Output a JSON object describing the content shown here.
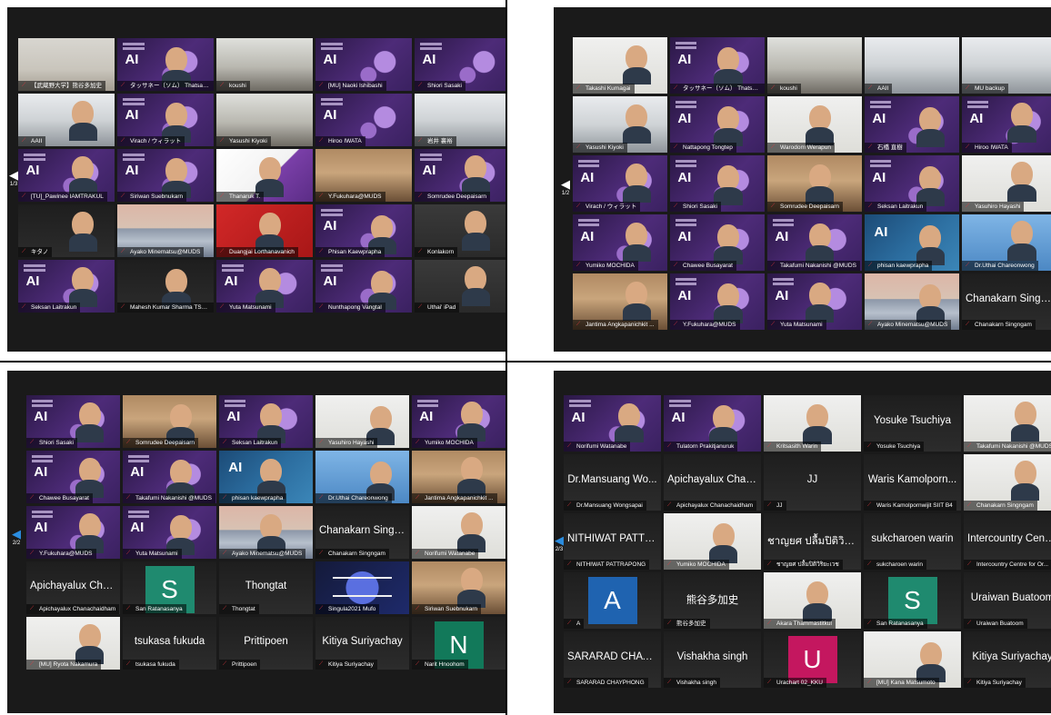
{
  "panels": [
    {
      "page": "1/3",
      "tiles": [
        {
          "name": "【武蔵野大学】熊谷多加史",
          "photo": "p-wall"
        },
        {
          "name": "タッサネー（ソム） Thatsanee (...",
          "photo": "p-ai",
          "face": true
        },
        {
          "name": "koushi",
          "photo": "p-room"
        },
        {
          "name": "[MU] Naoki Ishibashi",
          "photo": "p-ai"
        },
        {
          "name": "Shiori Sasaki",
          "photo": "p-ai"
        },
        {
          "name": "AAII",
          "photo": "p-office",
          "face": true
        },
        {
          "name": "Virach / ウィラット",
          "photo": "p-ai",
          "face": true,
          "highlight": true
        },
        {
          "name": "Yasushi Kiyoki",
          "photo": "p-room"
        },
        {
          "name": "Hiroo IWATA",
          "photo": "p-ai"
        },
        {
          "name": "岩井 裏裕",
          "photo": "p-office"
        },
        {
          "name": "[TU]_Pawinee IAMTRAKUL",
          "photo": "p-ai",
          "face": true
        },
        {
          "name": "Siriwan Suebnukarn",
          "photo": "p-ai",
          "face": true
        },
        {
          "name": "Thanaruk T.",
          "photo": "p-siit",
          "face": true
        },
        {
          "name": "Y.Fukuhara@MUDS",
          "photo": "p-home"
        },
        {
          "name": "Somrudee Deepaisarn",
          "photo": "p-ai",
          "face": true
        },
        {
          "name": "キタノ",
          "photo": "p-blk",
          "face": true
        },
        {
          "name": "Ayako Minematsu@MUDS",
          "photo": "p-mtn"
        },
        {
          "name": "Duangjai Lorthanavanich",
          "photo": "p-red",
          "face": true
        },
        {
          "name": "Phisan Kaewprapha",
          "photo": "p-ai",
          "face": true
        },
        {
          "name": "Konlakorn",
          "photo": "p-dark",
          "face": true
        },
        {
          "name": "Seksan Laitrakun",
          "photo": "p-ai",
          "face": true
        },
        {
          "name": "Mahesh Kumar Sharma TSE...",
          "photo": "p-blk",
          "face": true
        },
        {
          "name": "Yuta Matsunami",
          "photo": "p-ai",
          "face": true
        },
        {
          "name": "Nunthapong Vangtal",
          "photo": "p-ai",
          "face": true
        },
        {
          "name": "Uthai' iPad",
          "photo": "p-dark",
          "face": true
        }
      ]
    },
    {
      "page": "1/2",
      "tiles": [
        {
          "name": "Takashi Kumagai",
          "photo": "p-white",
          "face": true
        },
        {
          "name": "タッサネー（ソム） Thatsanee (...",
          "photo": "p-ai",
          "face": true
        },
        {
          "name": "koushi",
          "photo": "p-room",
          "highlight": true
        },
        {
          "name": "AAII",
          "photo": "p-office"
        },
        {
          "name": "MU backup",
          "photo": "p-office"
        },
        {
          "name": "Yasushi Kiyoki",
          "photo": "p-office",
          "face": true
        },
        {
          "name": "Nattapong Tongtep",
          "photo": "p-ai",
          "face": true
        },
        {
          "name": "Warodom Werapun",
          "photo": "p-white",
          "face": true
        },
        {
          "name": "石橋 直樹",
          "photo": "p-ai",
          "face": true
        },
        {
          "name": "Hiroo IWATA",
          "photo": "p-ai",
          "face": true
        },
        {
          "name": "Virach / ウィラット",
          "photo": "p-ai",
          "face": true
        },
        {
          "name": "Shiori Sasaki",
          "photo": "p-ai",
          "face": true
        },
        {
          "name": "Somrudee Deepaisarn",
          "photo": "p-home",
          "face": true
        },
        {
          "name": "Seksan Laitrakun",
          "photo": "p-ai",
          "face": true
        },
        {
          "name": "Yasuhiro Hayashi",
          "photo": "p-white",
          "face": true
        },
        {
          "name": "Yumiko MOCHIDA",
          "photo": "p-ai",
          "face": true
        },
        {
          "name": "Chawee Busayarat",
          "photo": "p-ai",
          "face": true
        },
        {
          "name": "Takafumi Nakanishi @MUDS",
          "photo": "p-ai",
          "face": true
        },
        {
          "name": "phisan kaewprapha",
          "photo": "p-ai2",
          "face": true
        },
        {
          "name": "Dr.Uthai Chareonwong",
          "photo": "p-blue",
          "face": true
        },
        {
          "name": "Jantima Angkapanichkit ...",
          "photo": "p-home",
          "face": true
        },
        {
          "name": "Y.Fukuhara@MUDS",
          "photo": "p-ai",
          "face": true
        },
        {
          "name": "Yuta Matsunami",
          "photo": "p-ai",
          "face": true
        },
        {
          "name": "Ayako Minematsu@MUDS",
          "photo": "p-mtn",
          "face": true
        },
        {
          "name": "Chanakarn Singngam",
          "photo": "p-blk",
          "label": "Chanakarn Singn..."
        }
      ]
    },
    {
      "page": "2/2",
      "tiles": [
        {
          "name": "Shiori Sasaki",
          "photo": "p-ai",
          "face": true
        },
        {
          "name": "Somrudee Deepaisarn",
          "photo": "p-home",
          "face": true
        },
        {
          "name": "Seksan Laitrakun",
          "photo": "p-ai",
          "face": true
        },
        {
          "name": "Yasuhiro Hayashi",
          "photo": "p-white",
          "face": true
        },
        {
          "name": "Yumiko MOCHIDA",
          "photo": "p-ai",
          "face": true
        },
        {
          "name": "Chawee Busayarat",
          "photo": "p-ai",
          "face": true
        },
        {
          "name": "Takafumi Nakanishi @MUDS",
          "photo": "p-ai",
          "face": true
        },
        {
          "name": "phisan kaewprapha",
          "photo": "p-ai2",
          "face": true
        },
        {
          "name": "Dr.Uthai Chareonwong",
          "photo": "p-blue",
          "face": true
        },
        {
          "name": "Jantima Angkapanichkit ...",
          "photo": "p-home",
          "face": true
        },
        {
          "name": "Y.Fukuhara@MUDS",
          "photo": "p-ai",
          "face": true
        },
        {
          "name": "Yuta Matsunami",
          "photo": "p-ai",
          "face": true
        },
        {
          "name": "Ayako Minematsu@MUDS",
          "photo": "p-mtn",
          "face": true
        },
        {
          "name": "Chanakarn Singngam",
          "photo": "p-blk",
          "label": "Chanakarn Singn..."
        },
        {
          "name": "Norifumi Watanabe",
          "photo": "p-white",
          "face": true
        },
        {
          "name": "Apichayalux Chanachaidham",
          "photo": "p-blk",
          "label": "Apichayalux Chan..."
        },
        {
          "name": "San Ratanasanya",
          "photo": "p-blk",
          "avatar": "S",
          "avatar_color": "#1f8a6f"
        },
        {
          "name": "Thongtat",
          "photo": "p-blk",
          "label": "Thongtat"
        },
        {
          "name": "Singula2021 Mufo",
          "photo": "p-sing"
        },
        {
          "name": "Siriwan Suebnukarn",
          "photo": "p-home",
          "face": true
        },
        {
          "name": "[MU] Ryota Nakamura",
          "photo": "p-white",
          "face": true
        },
        {
          "name": "tsukasa fukuda",
          "photo": "p-blk",
          "label": "tsukasa fukuda"
        },
        {
          "name": "Prittipoen",
          "photo": "p-blk",
          "label": "Prittipoen"
        },
        {
          "name": "Kitiya Suriyachay",
          "photo": "p-blk",
          "label": "Kitiya Suriyachay"
        },
        {
          "name": "Narit Hnoohom",
          "photo": "p-blk",
          "avatar": "N",
          "avatar_color": "#12795a"
        }
      ]
    },
    {
      "page": "2/3",
      "tiles": [
        {
          "name": "Norifumi Watanabe",
          "photo": "p-ai",
          "face": true
        },
        {
          "name": "Tulatorn Prakitjanuruk",
          "photo": "p-ai",
          "face": true
        },
        {
          "name": "Kritsasith Warin",
          "photo": "p-white",
          "face": true
        },
        {
          "name": "Yosuke Tsuchiya",
          "photo": "p-blk",
          "label": "Yosuke Tsuchiya"
        },
        {
          "name": "Takafumi Nakanishi @MUDS",
          "photo": "p-white",
          "face": true
        },
        {
          "name": "Dr.Mansuang Wongsapai",
          "photo": "p-blk",
          "label": "Dr.Mansuang Wo..."
        },
        {
          "name": "Apichayalux Chanachaidham",
          "photo": "p-blk",
          "label": "Apichayalux Chan..."
        },
        {
          "name": "JJ",
          "photo": "p-blk",
          "label": "JJ"
        },
        {
          "name": "Waris Kamolpornwijit SIIT B4",
          "photo": "p-blk",
          "label": "Waris Kamolporn..."
        },
        {
          "name": "Chanakarn Singngam",
          "photo": "p-white",
          "face": true
        },
        {
          "name": "NITHIWAT PATTRAPONG",
          "photo": "p-blk",
          "label": "NITHIWAT PATTR..."
        },
        {
          "name": "Yumiko MOCHIDA",
          "photo": "p-white",
          "face": true
        },
        {
          "name": "ชาญยศ ปลื้มปิติวิริยะเวช",
          "photo": "p-blk",
          "label": "ชาญยศ ปลื้มปิติวิริ..."
        },
        {
          "name": "sukcharoen warin",
          "photo": "p-blk",
          "label": "sukcharoen warin"
        },
        {
          "name": "Intercountry Centre for Or...",
          "photo": "p-blk",
          "label": "Intercountry Centr..."
        },
        {
          "name": "A",
          "photo": "p-blk",
          "avatar": "A",
          "avatar_color": "#1f63b0"
        },
        {
          "name": "熊谷多加史",
          "photo": "p-blk",
          "label": "熊谷多加史"
        },
        {
          "name": "Akara Thammastitkul",
          "photo": "p-white",
          "face": true
        },
        {
          "name": "San Ratanasanya",
          "photo": "p-blk",
          "avatar": "S",
          "avatar_color": "#1f8a6f"
        },
        {
          "name": "Uraiwan Buatoom",
          "photo": "p-blk",
          "label": "Uraiwan Buatoom"
        },
        {
          "name": "SARARAD CHAYPHONG",
          "photo": "p-blk",
          "label": "SARARAD CHAYP..."
        },
        {
          "name": "Vishakha singh",
          "photo": "p-blk",
          "label": "Vishakha singh"
        },
        {
          "name": "Urachart 02_KKU",
          "photo": "p-blk",
          "avatar": "U",
          "avatar_color": "#c4175f"
        },
        {
          "name": "[MU] Kana Matsumoto",
          "photo": "p-white",
          "face": true
        },
        {
          "name": "Kitiya Suriyachay",
          "photo": "p-blk",
          "label": "Kitiya Suriyachay"
        }
      ]
    }
  ]
}
